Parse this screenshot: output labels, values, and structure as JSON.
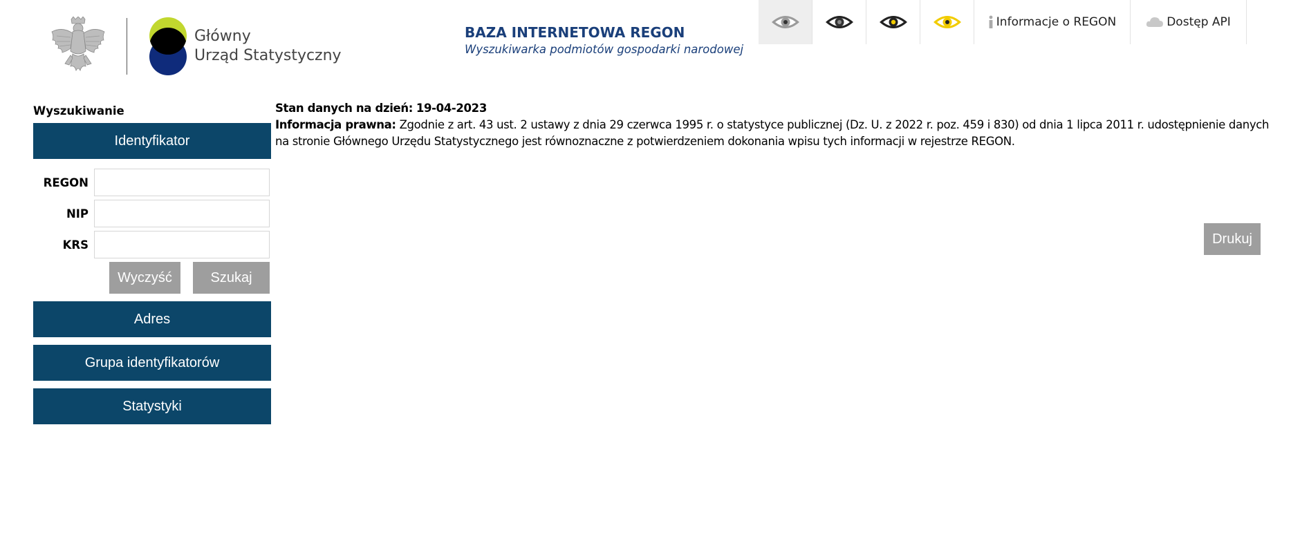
{
  "header": {
    "gus_name_line1": "Główny",
    "gus_name_line2": "Urząd Statystyczny",
    "portal_title": "BAZA INTERNETOWA REGON",
    "portal_subtitle": "Wyszukiwarka podmiotów gospodarki narodowej",
    "contrast_modes": [
      {
        "icon": "eye-gray-icon",
        "iris": "#9b9b9b",
        "pupil": "#333333",
        "sclera": "#ffffff",
        "outline": "#9b9b9b"
      },
      {
        "icon": "eye-black-icon",
        "iris": "#333333",
        "pupil": "#888888",
        "sclera": "#ffffff",
        "outline": "#222222"
      },
      {
        "icon": "eye-black-yellow-icon",
        "iris": "#222222",
        "pupil": "#f2cc00",
        "sclera": "#ffffff",
        "outline": "#222222"
      },
      {
        "icon": "eye-yellow-icon",
        "iris": "#f2cc00",
        "pupil": "#222222",
        "sclera": "#ffffff",
        "outline": "#f2cc00"
      }
    ],
    "nav_info": "Informacje o REGON",
    "nav_api": "Dostęp API"
  },
  "sidebar": {
    "title": "Wyszukiwanie",
    "identifier_section": "Identyfikator",
    "fields": {
      "regon_label": "REGON",
      "regon_value": "",
      "nip_label": "NIP",
      "nip_value": "",
      "krs_label": "KRS",
      "krs_value": ""
    },
    "clear_button": "Wyczyść",
    "search_button": "Szukaj",
    "address_section": "Adres",
    "group_section": "Grupa identyfikatorów",
    "stats_section": "Statystyki"
  },
  "main": {
    "data_state_label": "Stan danych na dzień:",
    "data_state_date": "19-04-2023",
    "legal_label": "Informacja prawna:",
    "legal_text": "Zgodnie z art. 43 ust. 2 ustawy z dnia 29 czerwca 1995 r. o statystyce publicznej (Dz. U. z 2022 r. poz. 459 i 830) od dnia 1 lipca 2011 r. udostępnienie danych na stronie Głównego Urzędu Statystycznego jest równoznaczne z potwierdzeniem dokonania wpisu tych informacji w rejestrze REGON.",
    "print_button": "Drukuj"
  },
  "colors": {
    "section_blue": "#0c4669",
    "button_gray": "#9e9e9e",
    "title_blue": "#1a3f7a",
    "gus_green": "#c1d72e",
    "gus_navy": "#0f2b7b"
  }
}
